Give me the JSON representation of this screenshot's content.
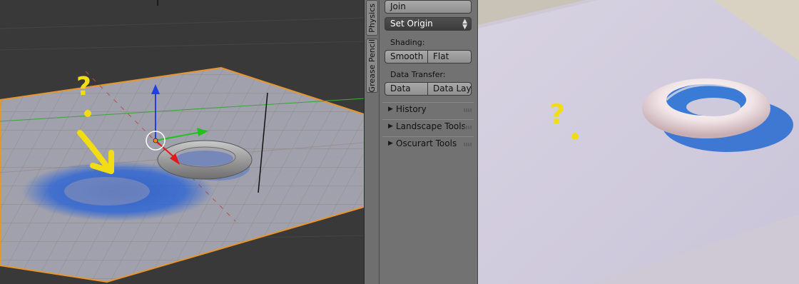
{
  "tabs": [
    {
      "label": "Physics"
    },
    {
      "label": "Grease Pencil"
    }
  ],
  "tools": {
    "join_label": "Join",
    "set_origin_label": "Set Origin",
    "shading_label": "Shading:",
    "smooth_label": "Smooth",
    "flat_label": "Flat",
    "data_transfer_label": "Data Transfer:",
    "data_label": "Data",
    "data_layout_label": "Data Layo"
  },
  "sections": [
    {
      "title": "History"
    },
    {
      "title": "Landscape Tools"
    },
    {
      "title": "Oscurart Tools"
    }
  ],
  "annotations": {
    "left_mark": "?",
    "right_mark": "?"
  },
  "colors": {
    "selection_outline": "#e8962c",
    "annotation_yellow": "#f2dd14",
    "shadow_blue": "#1f57c9",
    "axis_blue": "#1f3fe0",
    "axis_green": "#22c21e",
    "axis_red": "#e01a1a"
  }
}
